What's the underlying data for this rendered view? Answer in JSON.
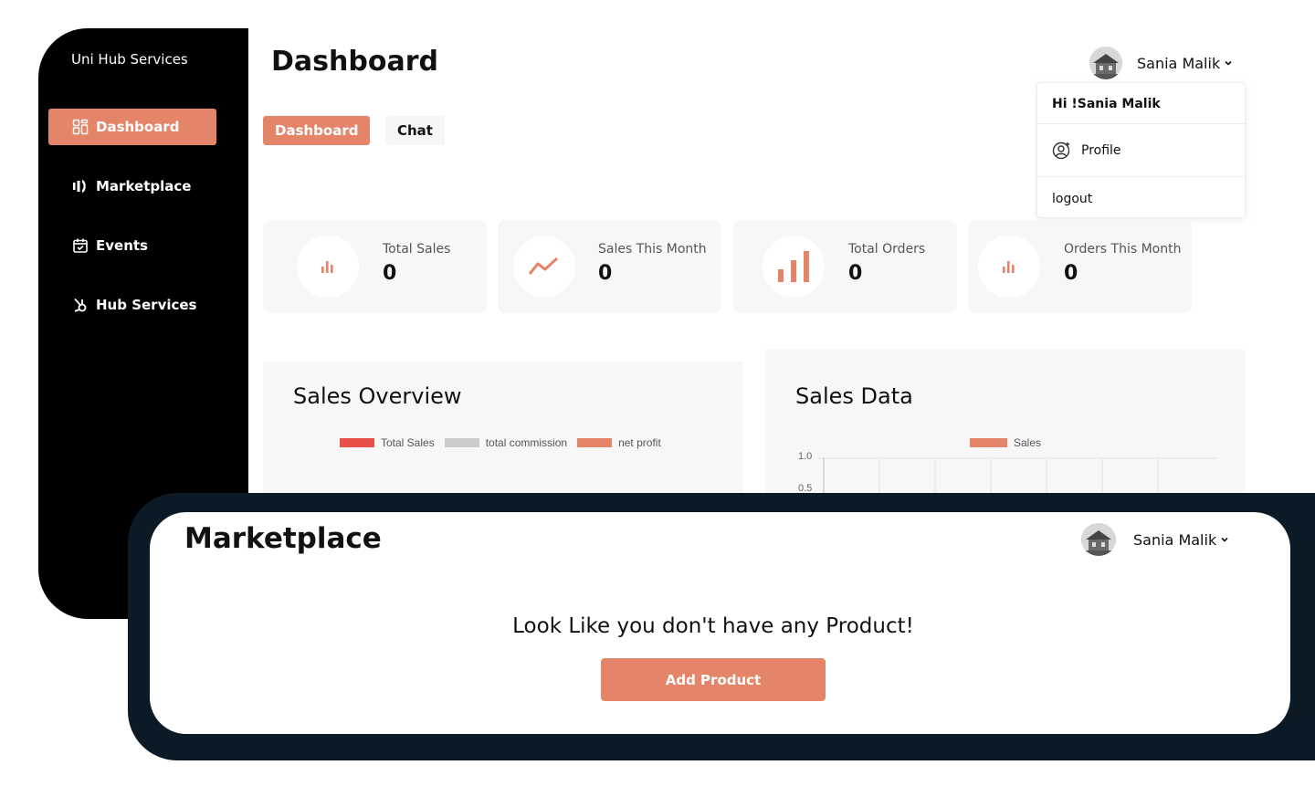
{
  "sidebar": {
    "brand": "Uni Hub Services",
    "items": [
      {
        "label": "Dashboard",
        "icon": "grid-icon"
      },
      {
        "label": "Marketplace",
        "icon": "marketplace-icon"
      },
      {
        "label": "Events",
        "icon": "calendar-icon"
      },
      {
        "label": "Hub Services",
        "icon": "hub-icon"
      }
    ]
  },
  "header": {
    "title": "Dashboard",
    "user_name": "Sania Malik"
  },
  "tabs": [
    {
      "label": "Dashboard"
    },
    {
      "label": "Chat"
    }
  ],
  "user_menu": {
    "greeting": "Hi !Sania Malik",
    "profile": "Profile",
    "logout": "logout"
  },
  "stats": [
    {
      "label": "Total Sales",
      "value": "0",
      "icon": "bar-chart-icon"
    },
    {
      "label": "Sales This Month",
      "value": "0",
      "icon": "trend-line-icon"
    },
    {
      "label": "Total Orders",
      "value": "0",
      "icon": "bar-chart-icon"
    },
    {
      "label": "Orders This Month",
      "value": "0",
      "icon": "bar-chart-icon"
    }
  ],
  "colors": {
    "accent": "#e4856a",
    "sidebar": "#000000",
    "frame": "#0b1a24",
    "red": "#e8504a",
    "gray": "#cccccc"
  },
  "sales_overview": {
    "title": "Sales Overview",
    "legend": [
      "Total Sales",
      "total commission",
      "net profit"
    ]
  },
  "sales_data": {
    "title": "Sales Data",
    "legend": [
      "Sales"
    ],
    "y_ticks": [
      "1.0",
      "0.5"
    ]
  },
  "marketplace": {
    "title": "Marketplace",
    "user_name": "Sania Malik",
    "empty_message": "Look Like you don't have any Product!",
    "add_button": "Add Product"
  }
}
